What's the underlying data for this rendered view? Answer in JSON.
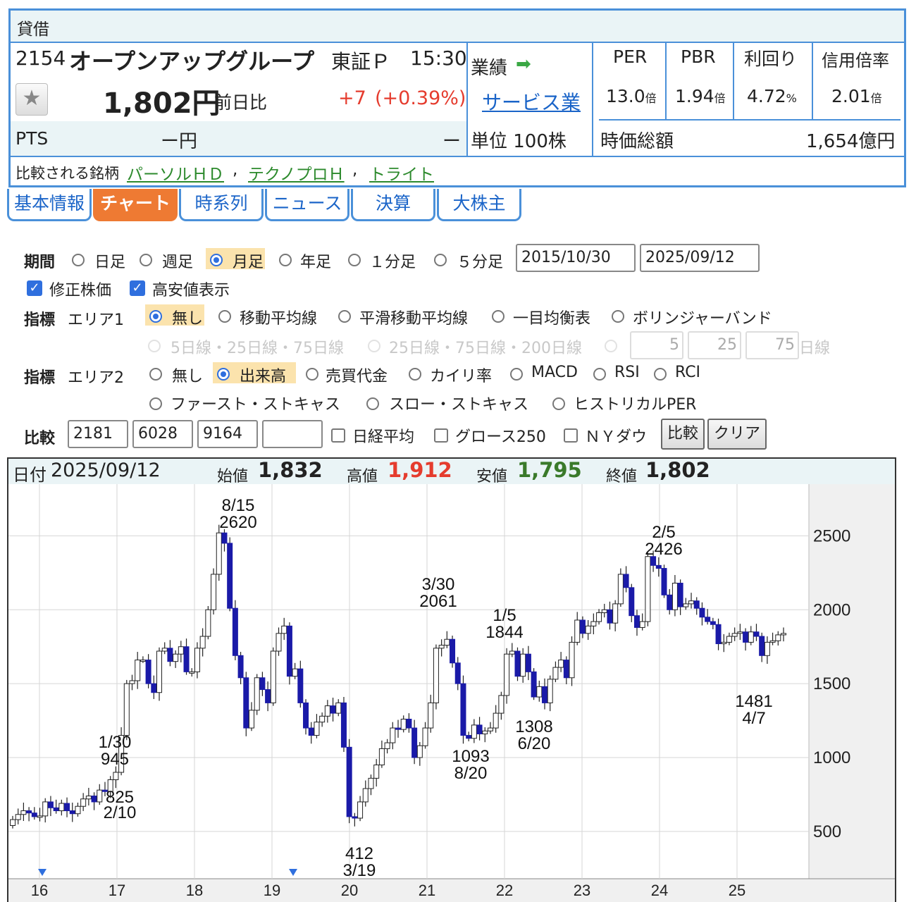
{
  "header": {
    "badge": "貸借",
    "code": "2154",
    "company_name": "オープンアップグループ",
    "market": "東証Ｐ",
    "time": "15:30",
    "price": "1,802円",
    "change_label": "前日比",
    "change": "+7",
    "change_pct": "(+0.39%)",
    "pts_label": "PTS",
    "pts_value": "ー円",
    "pts_change": "ー",
    "gyoseki_label": "業績",
    "sector": "サービス業",
    "unit": "単位 100株",
    "ratios": [
      {
        "label": "PER",
        "value": "13.0",
        "unit": "倍"
      },
      {
        "label": "PBR",
        "value": "1.94",
        "unit": "倍"
      },
      {
        "label": "利回り",
        "value": "4.72",
        "unit": "%"
      },
      {
        "label": "信用倍率",
        "value": "2.01",
        "unit": "倍"
      }
    ],
    "market_cap_label": "時価総額",
    "market_cap": "1,654億円",
    "compare_label": "比較される銘柄",
    "compare_links": [
      "パーソルＨＤ",
      "テクノプロＨ",
      "トライト"
    ],
    "compare_sep": ","
  },
  "tabs": [
    "基本情報",
    "チャート",
    "時系列",
    "ニュース",
    "決算",
    "大株主"
  ],
  "form": {
    "period_label": "期間",
    "period_options": [
      "日足",
      "週足",
      "月足",
      "年足",
      "１分足",
      "５分足"
    ],
    "period_selected": "月足",
    "date_from": "2015/10/30",
    "date_to": "2025/09/12",
    "check_adjusted": "修正株価",
    "check_highlow": "高安値表示",
    "indicator_label": "指標",
    "area1_label": "エリア1",
    "area1_options": [
      "無し",
      "移動平均線",
      "平滑移動平均線",
      "一目均衡表",
      "ボリンジャーバンド"
    ],
    "area1_selected": "無し",
    "ma_options": [
      "5日線・25日線・75日線",
      "25日線・75日線・200日線"
    ],
    "ma_inputs": [
      "5",
      "25",
      "75"
    ],
    "ma_unit": "日線",
    "area2_label": "エリア2",
    "area2_options": [
      "無し",
      "出来高",
      "売買代金",
      "カイリ率",
      "MACD",
      "RSI",
      "RCI",
      "ファースト・ストキャス",
      "スロー・ストキャス",
      "ヒストリカルPER"
    ],
    "area2_selected": "出来高",
    "compare_label": "比較",
    "compare_inputs": [
      "2181",
      "6028",
      "9164",
      ""
    ],
    "compare_checks": [
      "日経平均",
      "グロース250",
      "ＮＹダウ"
    ],
    "compare_button": "比較",
    "clear_button": "クリア"
  },
  "chart_head": {
    "date_label": "日付",
    "date": "2025/09/12",
    "open_label": "始値",
    "open": "1,832",
    "high_label": "高値",
    "high": "1,912",
    "low_label": "安値",
    "low": "1,795",
    "close_label": "終値",
    "close": "1,802",
    "colors": {
      "high": "#e53c2e",
      "low": "#3a7a2a"
    }
  },
  "chart_data": {
    "type": "candlestick",
    "x_ticks": [
      "16",
      "17",
      "18",
      "19",
      "20",
      "21",
      "22",
      "23",
      "24",
      "25"
    ],
    "y_ticks": [
      500,
      1000,
      1500,
      2000,
      2500
    ],
    "ylim": [
      180,
      2850
    ],
    "annotations": [
      {
        "date": "8/15",
        "value": "2620",
        "kind": "high"
      },
      {
        "date": "3/30",
        "value": "2061",
        "kind": "high"
      },
      {
        "date": "1/5",
        "value": "1844",
        "kind": "high"
      },
      {
        "date": "2/5",
        "value": "2426",
        "kind": "high"
      },
      {
        "date": "1/30",
        "value": "945",
        "kind": "high"
      },
      {
        "date": "2/10",
        "value": "825",
        "kind": "low"
      },
      {
        "date": "3/19",
        "value": "412",
        "kind": "low"
      },
      {
        "date": "8/20",
        "value": "1093",
        "kind": "low"
      },
      {
        "date": "6/20",
        "value": "1308",
        "kind": "low"
      },
      {
        "date": "4/7",
        "value": "1481",
        "kind": "low"
      }
    ],
    "colors": {
      "up": "#ffffff",
      "down": "#1a1aa8",
      "wick": "#222222"
    },
    "closes": [
      580,
      615,
      640,
      625,
      600,
      605,
      700,
      660,
      640,
      690,
      640,
      620,
      670,
      720,
      740,
      700,
      780,
      770,
      850,
      900,
      1150,
      1500,
      1520,
      1660,
      1660,
      1500,
      1440,
      1720,
      1740,
      1650,
      1700,
      1750,
      1580,
      1580,
      1740,
      1820,
      2000,
      2240,
      2520,
      2450,
      2010,
      1690,
      1540,
      1200,
      1320,
      1540,
      1460,
      1370,
      1720,
      1840,
      1890,
      1550,
      1600,
      1370,
      1200,
      1150,
      1240,
      1280,
      1350,
      1300,
      1370,
      1070,
      600,
      590,
      700,
      790,
      860,
      950,
      1060,
      1100,
      1200,
      1190,
      1260,
      1200,
      1000,
      1080,
      1200,
      1370,
      1740,
      1760,
      1800,
      1640,
      1500,
      1150,
      1130,
      1220,
      1160,
      1180,
      1200,
      1300,
      1420,
      1700,
      1720,
      1550,
      1700,
      1580,
      1410,
      1480,
      1370,
      1530,
      1610,
      1660,
      1540,
      1780,
      1930,
      1840,
      1890,
      1920,
      1980,
      2000,
      1910,
      2040,
      2240,
      2150,
      1960,
      1880,
      1920,
      2360,
      2300,
      2280,
      2100,
      2000,
      2180,
      2020,
      2040,
      2060,
      2010,
      1950,
      1920,
      1900,
      1770,
      1780,
      1820,
      1840,
      1850,
      1780,
      1850,
      1820,
      1690,
      1780,
      1790,
      1830,
      1840
    ]
  }
}
